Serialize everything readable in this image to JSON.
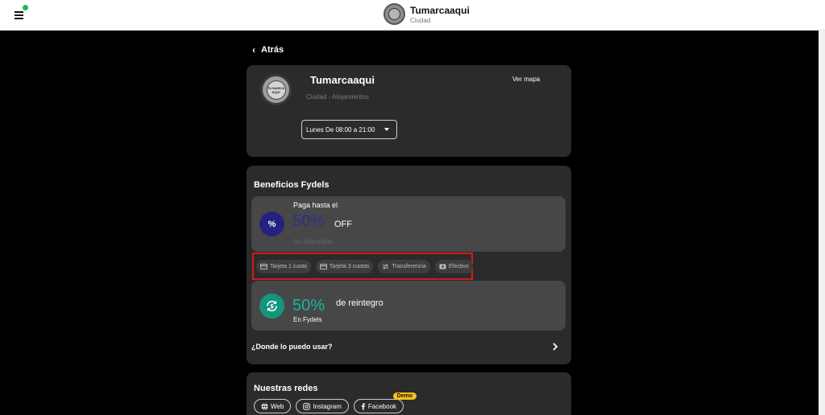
{
  "topbar": {
    "brand_name": "Tumarcaaqui",
    "brand_sub": "Ciudad",
    "menu_icon": "hamburger-menu-icon",
    "status_dot_color": "#1db954"
  },
  "back": {
    "label": "Atrás",
    "icon": "chevron-left-icon"
  },
  "header_card": {
    "logo_text": "TU MARCA AQUÍ",
    "name": "Tumarcaaqui",
    "subtitle": "Ciudad - Alojamientos",
    "map_link": "Ver mapa",
    "hours_selected": "Lunes De 08:00 a 21:00"
  },
  "benefits": {
    "title": "Beneficios Fydels",
    "discount": {
      "pay_label": "Paga hasta el",
      "percent": "50%",
      "suffix": "OFF",
      "status": "No disponible",
      "icon": "percent-icon",
      "color": "#2f2f8a"
    },
    "payment_methods": [
      {
        "label": "Tarjeta 1 cuota",
        "icon": "credit-card-icon"
      },
      {
        "label": "Tarjeta 3 cuotas",
        "icon": "credit-card-icon"
      },
      {
        "label": "Transferencia",
        "icon": "transfer-arrows-icon"
      },
      {
        "label": "Efectivo",
        "icon": "cash-icon"
      }
    ],
    "refund": {
      "percent": "50%",
      "suffix": "de reintegro",
      "source": "En Fydels",
      "icon": "refund-cycle-icon",
      "color": "#18b79b"
    },
    "where_label": "¿Donde lo puedo usar?"
  },
  "social": {
    "title": "Nuestras redes",
    "buttons": [
      {
        "label": "Web",
        "icon": "globe-icon"
      },
      {
        "label": "Instagram",
        "icon": "instagram-icon"
      },
      {
        "label": "Facebook",
        "icon": "facebook-icon"
      }
    ],
    "demo_badge": "Demo"
  }
}
